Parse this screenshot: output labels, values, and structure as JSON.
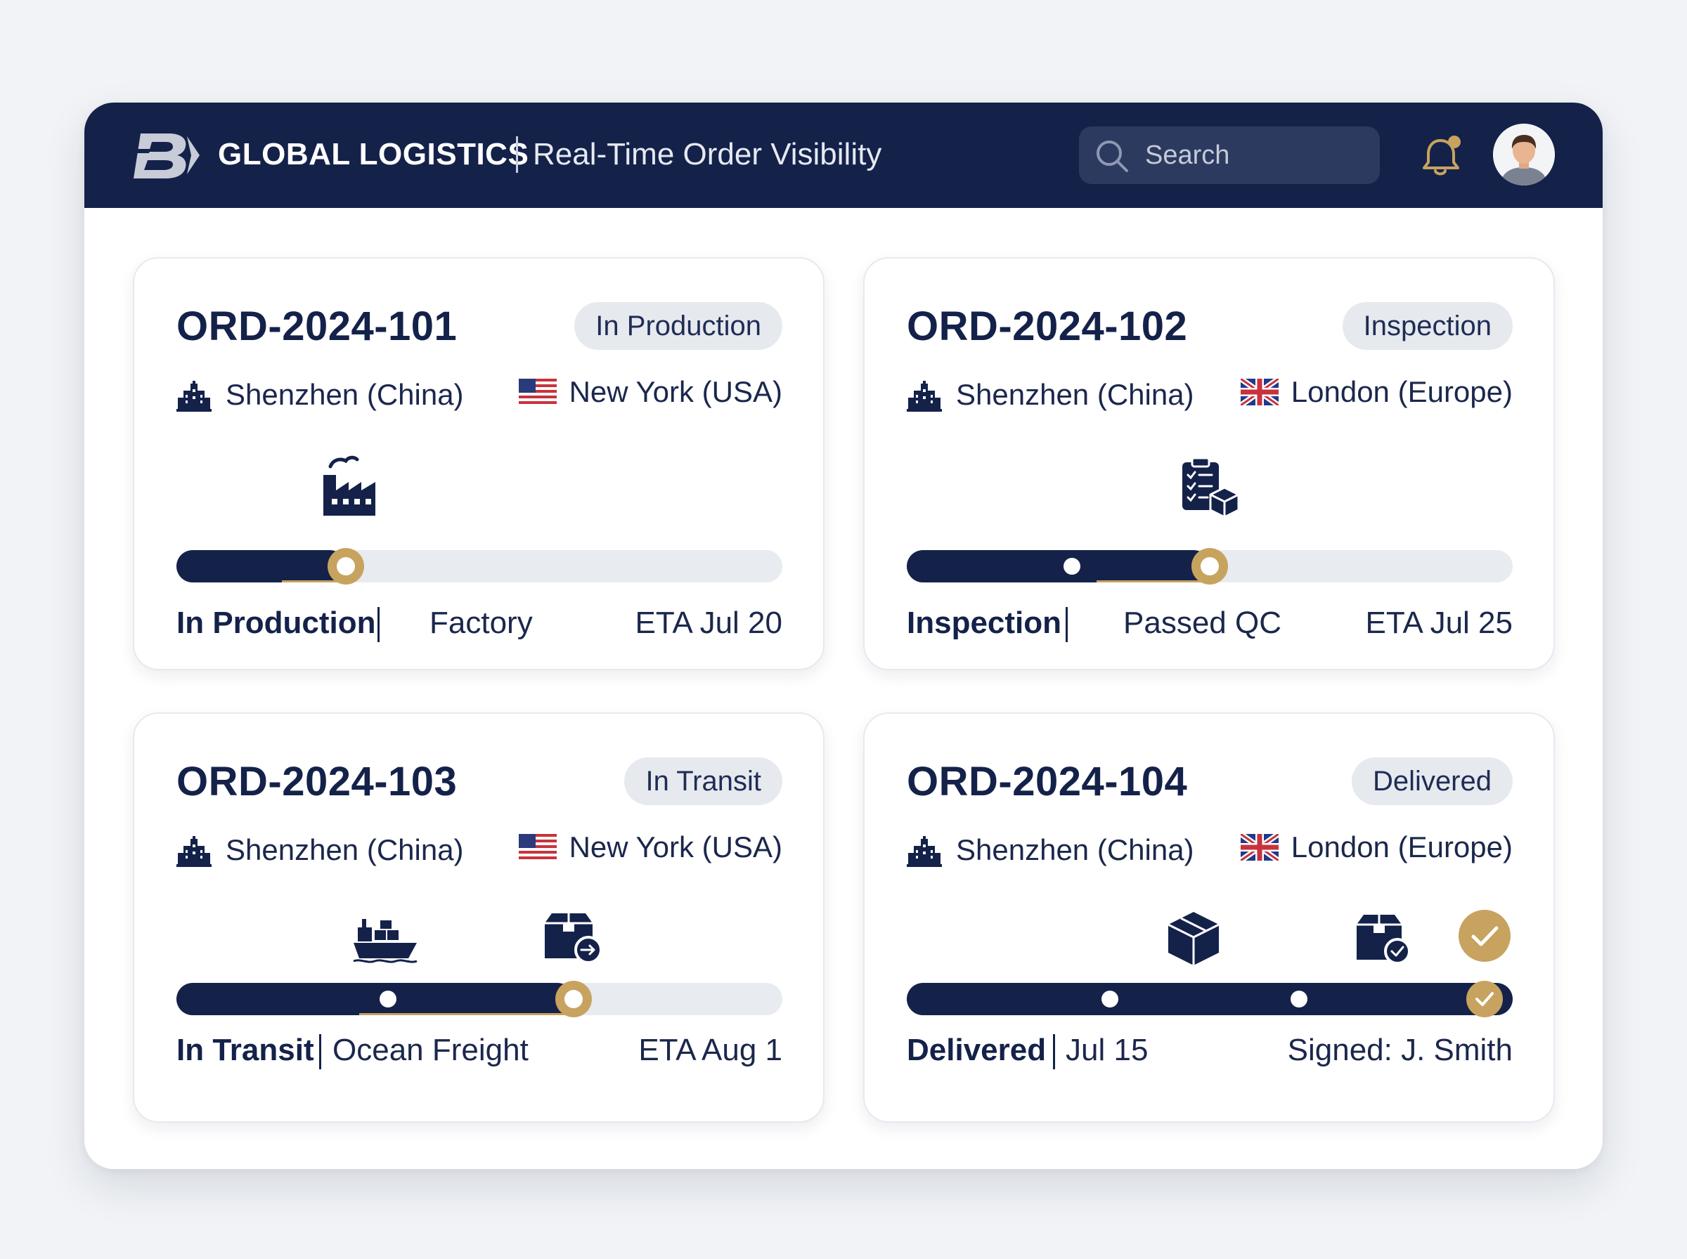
{
  "header": {
    "brand": "GLOBAL LOGISTICS",
    "subtitle": "Real-Time Order Visibility",
    "search_placeholder": "Search",
    "logo_icon": "b-logo-icon",
    "notification_icon": "bell-icon",
    "avatar_icon": "user-avatar"
  },
  "colors": {
    "navy": "#14224a",
    "gold": "#c7a35f",
    "track": "#e8ebf0",
    "badge": "#e6e9ee"
  },
  "orders": [
    {
      "id": "ORD-2024-101",
      "badge": "In Production",
      "origin": "Shenzhen (China)",
      "destination": "New York (USA)",
      "destination_flag": "us-flag-icon",
      "stage_icons": [
        "factory-icon"
      ],
      "progress": 0.28,
      "status": "In Production",
      "detail": "Factory",
      "right": "ETA Jul 20"
    },
    {
      "id": "ORD-2024-102",
      "badge": "Inspection",
      "origin": "Shenzhen (China)",
      "destination": "London (Europe)",
      "destination_flag": "uk-flag-icon",
      "stage_icons": [
        "clipboard-box-icon"
      ],
      "progress": 0.5,
      "status": "Inspection",
      "detail": "Passed QC",
      "right": "ETA Jul 25"
    },
    {
      "id": "ORD-2024-103",
      "badge": "In Transit",
      "origin": "Shenzhen (China)",
      "destination": "New York (USA)",
      "destination_flag": "us-flag-icon",
      "stage_icons": [
        "ship-icon",
        "package-arrow-icon"
      ],
      "progress": 0.655,
      "status": "In Transit",
      "detail": "Ocean Freight",
      "right": "ETA Aug 1"
    },
    {
      "id": "ORD-2024-104",
      "badge": "Delivered",
      "origin": "Shenzhen (China)",
      "destination": "London (Europe)",
      "destination_flag": "uk-flag-icon",
      "stage_icons": [
        "box-icon",
        "package-check-icon",
        "check-circle-icon"
      ],
      "progress": 1.0,
      "status": "Delivered",
      "detail": "Jul 15",
      "right": "Signed: J. Smith"
    }
  ]
}
